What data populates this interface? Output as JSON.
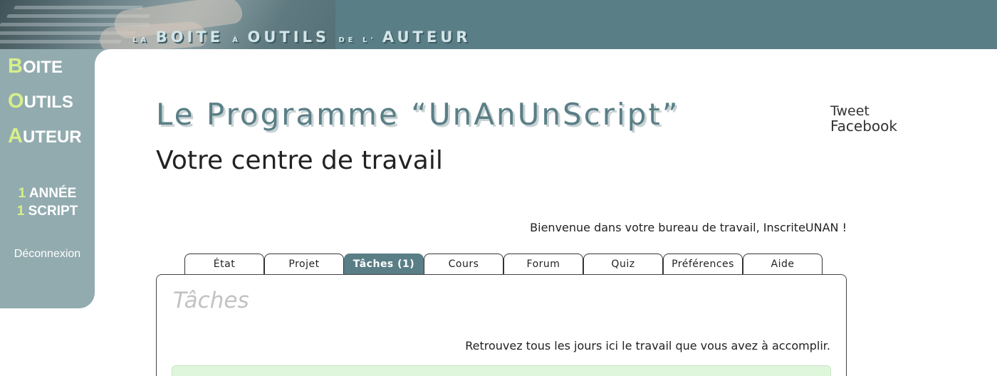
{
  "banner": {
    "title_parts": [
      {
        "text": "LA",
        "size": "small"
      },
      {
        "text": "BOITE",
        "size": "big"
      },
      {
        "text": "À",
        "size": "small"
      },
      {
        "text": "OUTILS",
        "size": "big"
      },
      {
        "text": "DE L'",
        "size": "small"
      },
      {
        "text": "AUTEUR",
        "size": "big"
      }
    ]
  },
  "sidebar": {
    "brand": [
      {
        "cap": "B",
        "rest": "OITE"
      },
      {
        "cap": "O",
        "rest": "UTILS"
      },
      {
        "cap": "A",
        "rest": "UTEUR"
      }
    ],
    "program": [
      {
        "num": "1",
        "word": "ANNÉE"
      },
      {
        "num": "1",
        "word": "SCRIPT"
      }
    ],
    "logout_label": "Déconnexion"
  },
  "main": {
    "title": "Le Programme “UnAnUnScript”",
    "subtitle": "Votre centre de travail",
    "welcome": "Bienvenue dans votre bureau de travail, InscriteUNAN !"
  },
  "social": {
    "tweet_label": "Tweet",
    "facebook_label": "Facebook"
  },
  "tabs": [
    {
      "label": "État",
      "active": false
    },
    {
      "label": "Projet",
      "active": false
    },
    {
      "label": "Tâches (1)",
      "active": true
    },
    {
      "label": "Cours",
      "active": false
    },
    {
      "label": "Forum",
      "active": false
    },
    {
      "label": "Quiz",
      "active": false
    },
    {
      "label": "Préférences",
      "active": false
    },
    {
      "label": "Aide",
      "active": false
    }
  ],
  "panel": {
    "title": "Tâches",
    "info": "Retrouvez tous les jours ici le travail que vous avez à accomplir."
  },
  "colors": {
    "accent": "#5a7e86",
    "sidebar": "#92abaf",
    "highlight": "#d6f08a",
    "success_box": "#dff5dc"
  }
}
